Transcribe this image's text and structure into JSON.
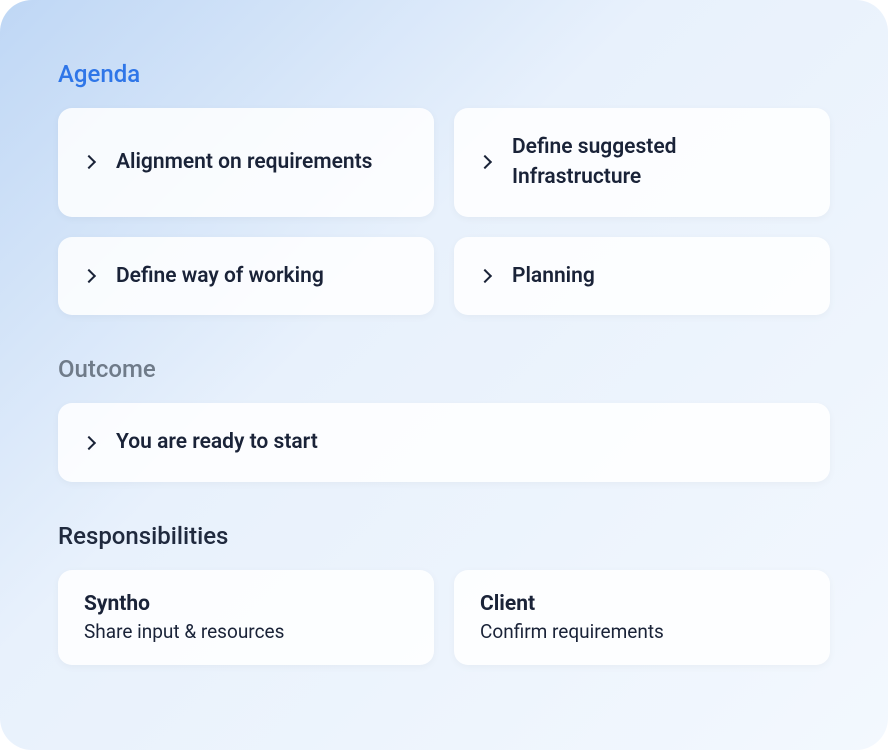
{
  "agenda": {
    "title": "Agenda",
    "items": [
      {
        "label": "Alignment on requirements"
      },
      {
        "label": "Define suggested Infrastructure"
      },
      {
        "label": "Define way of working"
      },
      {
        "label": "Planning"
      }
    ]
  },
  "outcome": {
    "title": "Outcome",
    "items": [
      {
        "label": "You are ready to start"
      }
    ]
  },
  "responsibilities": {
    "title": "Responsibilities",
    "items": [
      {
        "party": "Syntho",
        "task": "Share input & resources"
      },
      {
        "party": "Client",
        "task": "Confirm requirements"
      }
    ]
  }
}
